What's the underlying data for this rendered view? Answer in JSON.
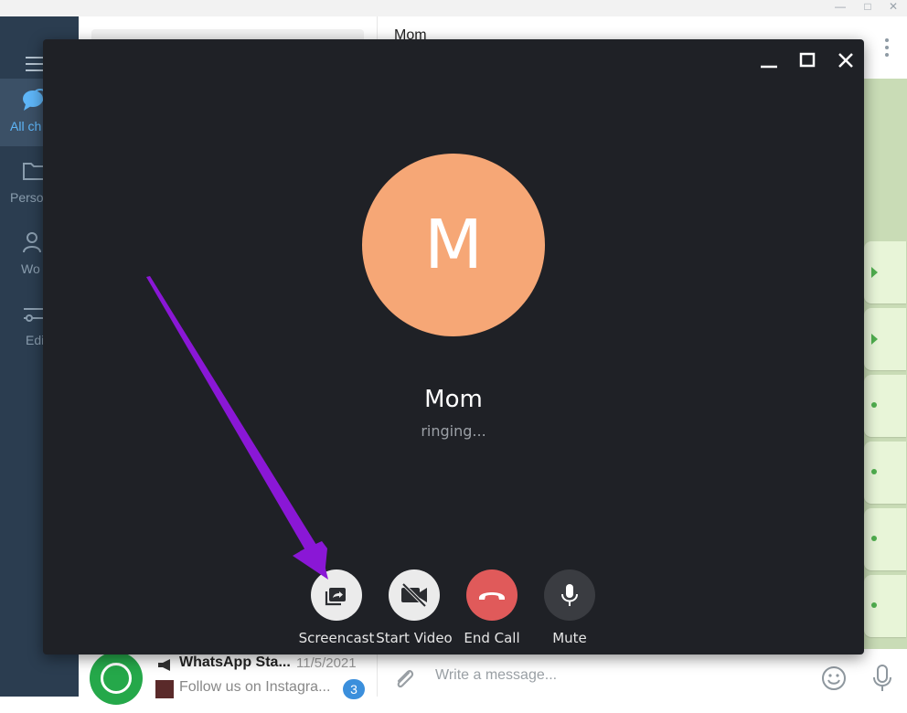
{
  "sidebar": {
    "folders": [
      {
        "label": "All ch",
        "icon": "chat-bubbles-icon",
        "active": true
      },
      {
        "label": "Perso",
        "icon": "folder-icon",
        "active": false
      },
      {
        "label": "Wo",
        "icon": "contacts-icon",
        "active": false
      },
      {
        "label": "Edi",
        "icon": "sliders-icon",
        "active": false
      }
    ]
  },
  "chat_list": {
    "row": {
      "name": "WhatsApp Sta...",
      "date": "11/5/2021",
      "preview": "Follow us on Instagra...",
      "unread": "3"
    }
  },
  "chat": {
    "title": "Mom",
    "compose_placeholder": "Write a message..."
  },
  "call": {
    "avatar_initial": "M",
    "caller_name": "Mom",
    "status": "ringing...",
    "buttons": {
      "screencast": "Screencast",
      "start_video": "Start Video",
      "end_call": "End Call",
      "mute": "Mute"
    }
  },
  "colors": {
    "sidebar_bg": "#2b3d50",
    "call_bg": "#1f2126",
    "avatar": "#f6a776",
    "end_call": "#e05a5a",
    "arrow": "#8a17d6",
    "chat_bg": "#c9dcb6"
  }
}
